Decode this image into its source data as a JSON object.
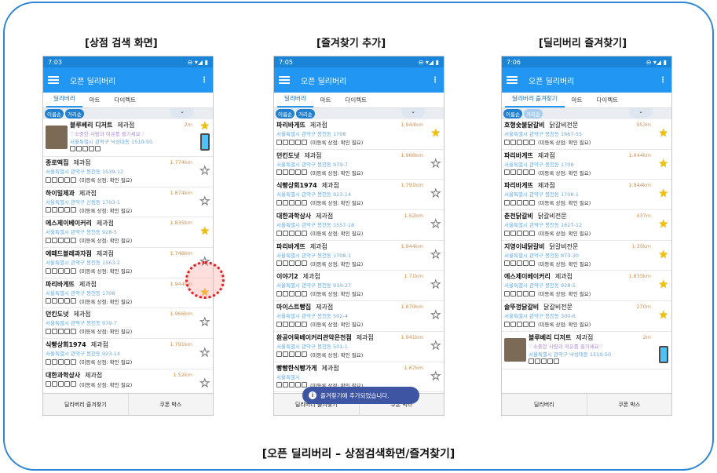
{
  "captions": {
    "left": "[상점 검색 화면]",
    "middle": "[즐겨찾기 추가]",
    "right": "[딜리버리 즐겨찾기]",
    "footer": "[오픈 딜리버리 – 상점검색화면/즐겨찾기]"
  },
  "common": {
    "app_title": "오픈 딜리버리",
    "more": "⋮",
    "sort_chips": [
      "이름순",
      "거리순"
    ],
    "dropdown": "⌄",
    "note": "(미등록 상점: 확인 필요)"
  },
  "phones": [
    {
      "time": "7:03",
      "tabs": [
        "딜리버리",
        "마트",
        "다이렉트"
      ],
      "bottom": [
        "딜리버리 즐겨찾기",
        "쿠폰 박스"
      ],
      "items": [
        {
          "ad": true,
          "name": "블루베리 디저트",
          "cat": "제과점",
          "dist": "2m",
          "addr": "♡소중한 사람과 여유를 즐기세요♡",
          "addr2": "서울특별시 관악구 낙성대동 1510-50",
          "star": true
        },
        {
          "name": "종로떡집",
          "cat": "제과점",
          "dist": "1.774km",
          "addr": "서울특별시 관악구 봉천동 1539-12",
          "star": false
        },
        {
          "name": "하이밀제과",
          "cat": "제과점",
          "dist": "1.874km",
          "addr": "서울특별시 관악구 신림동 1703-1",
          "star": false
        },
        {
          "name": "에스제이베이커리",
          "cat": "제과점",
          "dist": "1.835km",
          "addr": "서울특별시 관악구 봉천동 928-5",
          "star": true
        },
        {
          "name": "에떼드볼레과자점",
          "cat": "제과점",
          "dist": "1.746km",
          "addr": "서울특별시 관악구 봉천동 1563-2",
          "star": false
        },
        {
          "name": "파리바게뜨",
          "cat": "제과점",
          "dist": "1.944km",
          "addr": "서울특별시 관악구 봉천동 1708",
          "star": true
        },
        {
          "name": "던킨도넛",
          "cat": "제과점",
          "dist": "1.966km",
          "addr": "서울특별시 관악구 봉천동 979-7",
          "star": false
        },
        {
          "name": "식빵상회1974",
          "cat": "제과점",
          "dist": "1.791km",
          "addr": "서울특별시 관악구 봉천동 923-14",
          "star": false
        },
        {
          "name": "대한과학상사",
          "cat": "제과점",
          "dist": "1.52km",
          "addr": "",
          "star": false
        }
      ]
    },
    {
      "time": "7:05",
      "tabs": [
        "딜리버리",
        "마트",
        "다이렉트"
      ],
      "bottom": [
        "딜리버리 즐겨찾기",
        "쿠폰 박스"
      ],
      "items": [
        {
          "name": "파리바게뜨",
          "cat": "제과점",
          "dist": "1.944km",
          "addr": "서울특별시 관악구 봉천동 1708",
          "star": true
        },
        {
          "name": "던킨도넛",
          "cat": "제과점",
          "dist": "1.966km",
          "addr": "서울특별시 관악구 봉천동 979-7",
          "star": false
        },
        {
          "name": "식빵상회1974",
          "cat": "제과점",
          "dist": "1.791km",
          "addr": "서울특별시 관악구 봉천동 923-14",
          "star": false
        },
        {
          "name": "대한과학상사",
          "cat": "제과점",
          "dist": "1.52km",
          "addr": "서울특별시 관악구 봉천동 1557-18",
          "star": false
        },
        {
          "name": "파리바게뜨",
          "cat": "제과점",
          "dist": "1.944km",
          "addr": "서울특별시 관악구 봉천동 1708-1",
          "star": false
        },
        {
          "name": "이야기2",
          "cat": "제과점",
          "dist": "1.71km",
          "addr": "서울특별시 관악구 봉천동 910-27",
          "star": false
        },
        {
          "name": "마이스트빵집",
          "cat": "제과점",
          "dist": "1.879km",
          "addr": "서울특별시 관악구 봉천동 502-4",
          "star": false
        },
        {
          "name": "환공어묵베이커리관악은천점",
          "cat": "제과점",
          "dist": "1.941km",
          "addr": "서울특별시 관악구 봉천동 501-1",
          "star": false
        },
        {
          "name": "빵빵한식빵가게",
          "cat": "제과점",
          "dist": "1.67km",
          "addr": "서울특별시",
          "star": false
        }
      ],
      "toast": "즐겨찾기에 추가되었습니다."
    },
    {
      "time": "7:06",
      "tabs": [
        "딜리버리 즐겨찾기",
        "마트",
        "다이렉트"
      ],
      "bottom": [
        "딜리버리",
        "쿠폰 박스"
      ],
      "items": [
        {
          "name": "호형숯불닭갈비",
          "cat": "닭갈비전문",
          "dist": "953m",
          "addr": "서울특별시 관악구 봉천동 1667-55",
          "star": true
        },
        {
          "name": "파리바게뜨",
          "cat": "제과점",
          "dist": "1.944km",
          "addr": "서울특별시 관악구 봉천동 1708",
          "star": true
        },
        {
          "name": "파리바게뜨",
          "cat": "제과점",
          "dist": "1.944km",
          "addr": "서울특별시 관악구 봉천동 1708-1",
          "star": true
        },
        {
          "name": "춘천닭갈비",
          "cat": "닭갈비전문",
          "dist": "437m",
          "addr": "서울특별시 관악구 봉천동 1627-12",
          "star": true
        },
        {
          "name": "지영이네닭갈비",
          "cat": "닭갈비전문",
          "dist": "1.35km",
          "addr": "서울특별시 관악구 봉천동 873-30",
          "star": true
        },
        {
          "name": "에스제이베이커리",
          "cat": "제과점",
          "dist": "1.835km",
          "addr": "서울특별시 관악구 봉천동 928-5",
          "star": true
        },
        {
          "name": "솔뚜껑닭갈비",
          "cat": "닭갈비전문",
          "dist": "270m",
          "addr": "서울특별시 관악구 봉천동 300-6",
          "star": true
        },
        {
          "ad": true,
          "name": "블루베리 디저트",
          "cat": "제과점",
          "dist": "2m",
          "addr": "♡소중한 사람과 여유를 즐기세요♡",
          "addr2": "서울특별시 관악구 낙성대동 1510-50",
          "star": false
        }
      ]
    }
  ]
}
